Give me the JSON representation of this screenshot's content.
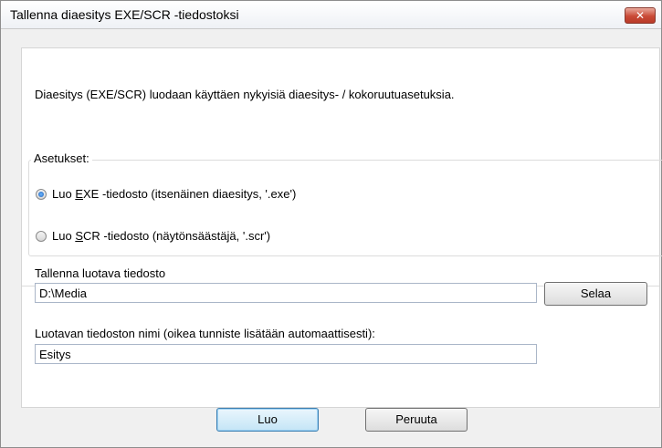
{
  "window": {
    "title": "Tallenna diaesitys EXE/SCR -tiedostoksi",
    "close_glyph": "✕"
  },
  "description": "Diaesitys (EXE/SCR) luodaan käyttäen nykyisiä diaesitys- / kokoruutuasetuksia.",
  "settings": {
    "label": "Asetukset:",
    "options": [
      {
        "prefix": "Luo ",
        "accel": "E",
        "suffix": "XE -tiedosto (itsenäinen diaesitys, '.exe')",
        "checked": true
      },
      {
        "prefix": "Luo ",
        "accel": "S",
        "suffix": "CR -tiedosto (näytönsäästäjä, '.scr')",
        "checked": false
      }
    ]
  },
  "save_location": {
    "label": "Tallenna luotava tiedosto",
    "value": "D:\\Media",
    "browse_label": "Selaa"
  },
  "file_name": {
    "label": "Luotavan tiedoston nimi (oikea tunniste lisätään automaattisesti):",
    "value": "Esitys"
  },
  "buttons": {
    "create_label": "Luo",
    "cancel_label": "Peruuta"
  }
}
